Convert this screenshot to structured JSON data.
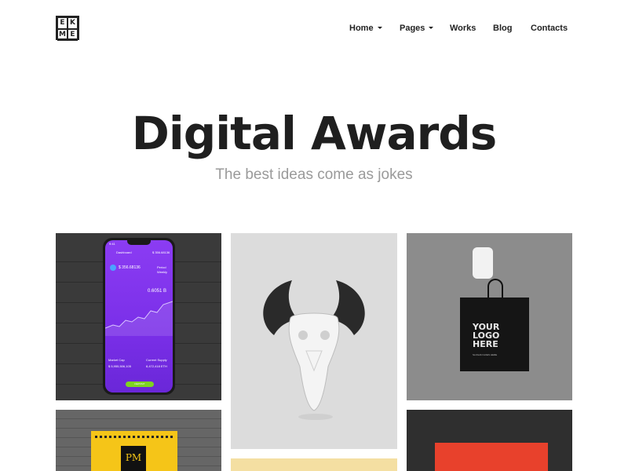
{
  "header": {
    "logo": [
      "E",
      "K",
      "M",
      "E"
    ],
    "nav": [
      {
        "label": "Home",
        "has_dropdown": true
      },
      {
        "label": "Pages",
        "has_dropdown": true
      },
      {
        "label": "Works",
        "has_dropdown": false
      },
      {
        "label": "Blog",
        "has_dropdown": false
      },
      {
        "label": "Contacts",
        "has_dropdown": false
      }
    ]
  },
  "hero": {
    "title": "Digital Awards",
    "subtitle": "The best ideas come as jokes"
  },
  "gallery": {
    "phone": {
      "time": "9:41",
      "app_title": "Dashboard",
      "balance": "$ 356.68136",
      "period_label": "Period",
      "period_value": "Weekly",
      "btc_value": "0.6051 B",
      "market_cap_label": "Market Cap",
      "market_cap_value": "$ 5,955,506,105",
      "supply_label": "Current Supply",
      "supply_value": "8,472,418 ETH",
      "button": "DEPOSIT"
    },
    "bag": {
      "logo_text": "YOUR\nLOGO\nHERE",
      "tagline": "SLOGAN GOES HERE"
    },
    "poster": {
      "monogram": "PM"
    }
  },
  "colors": {
    "accent_purple": "#7a2fe8",
    "poster_yellow": "#f5c518",
    "card_red": "#e8412c",
    "text_dark": "#1f1f1f",
    "text_muted": "#9a9a9a"
  }
}
